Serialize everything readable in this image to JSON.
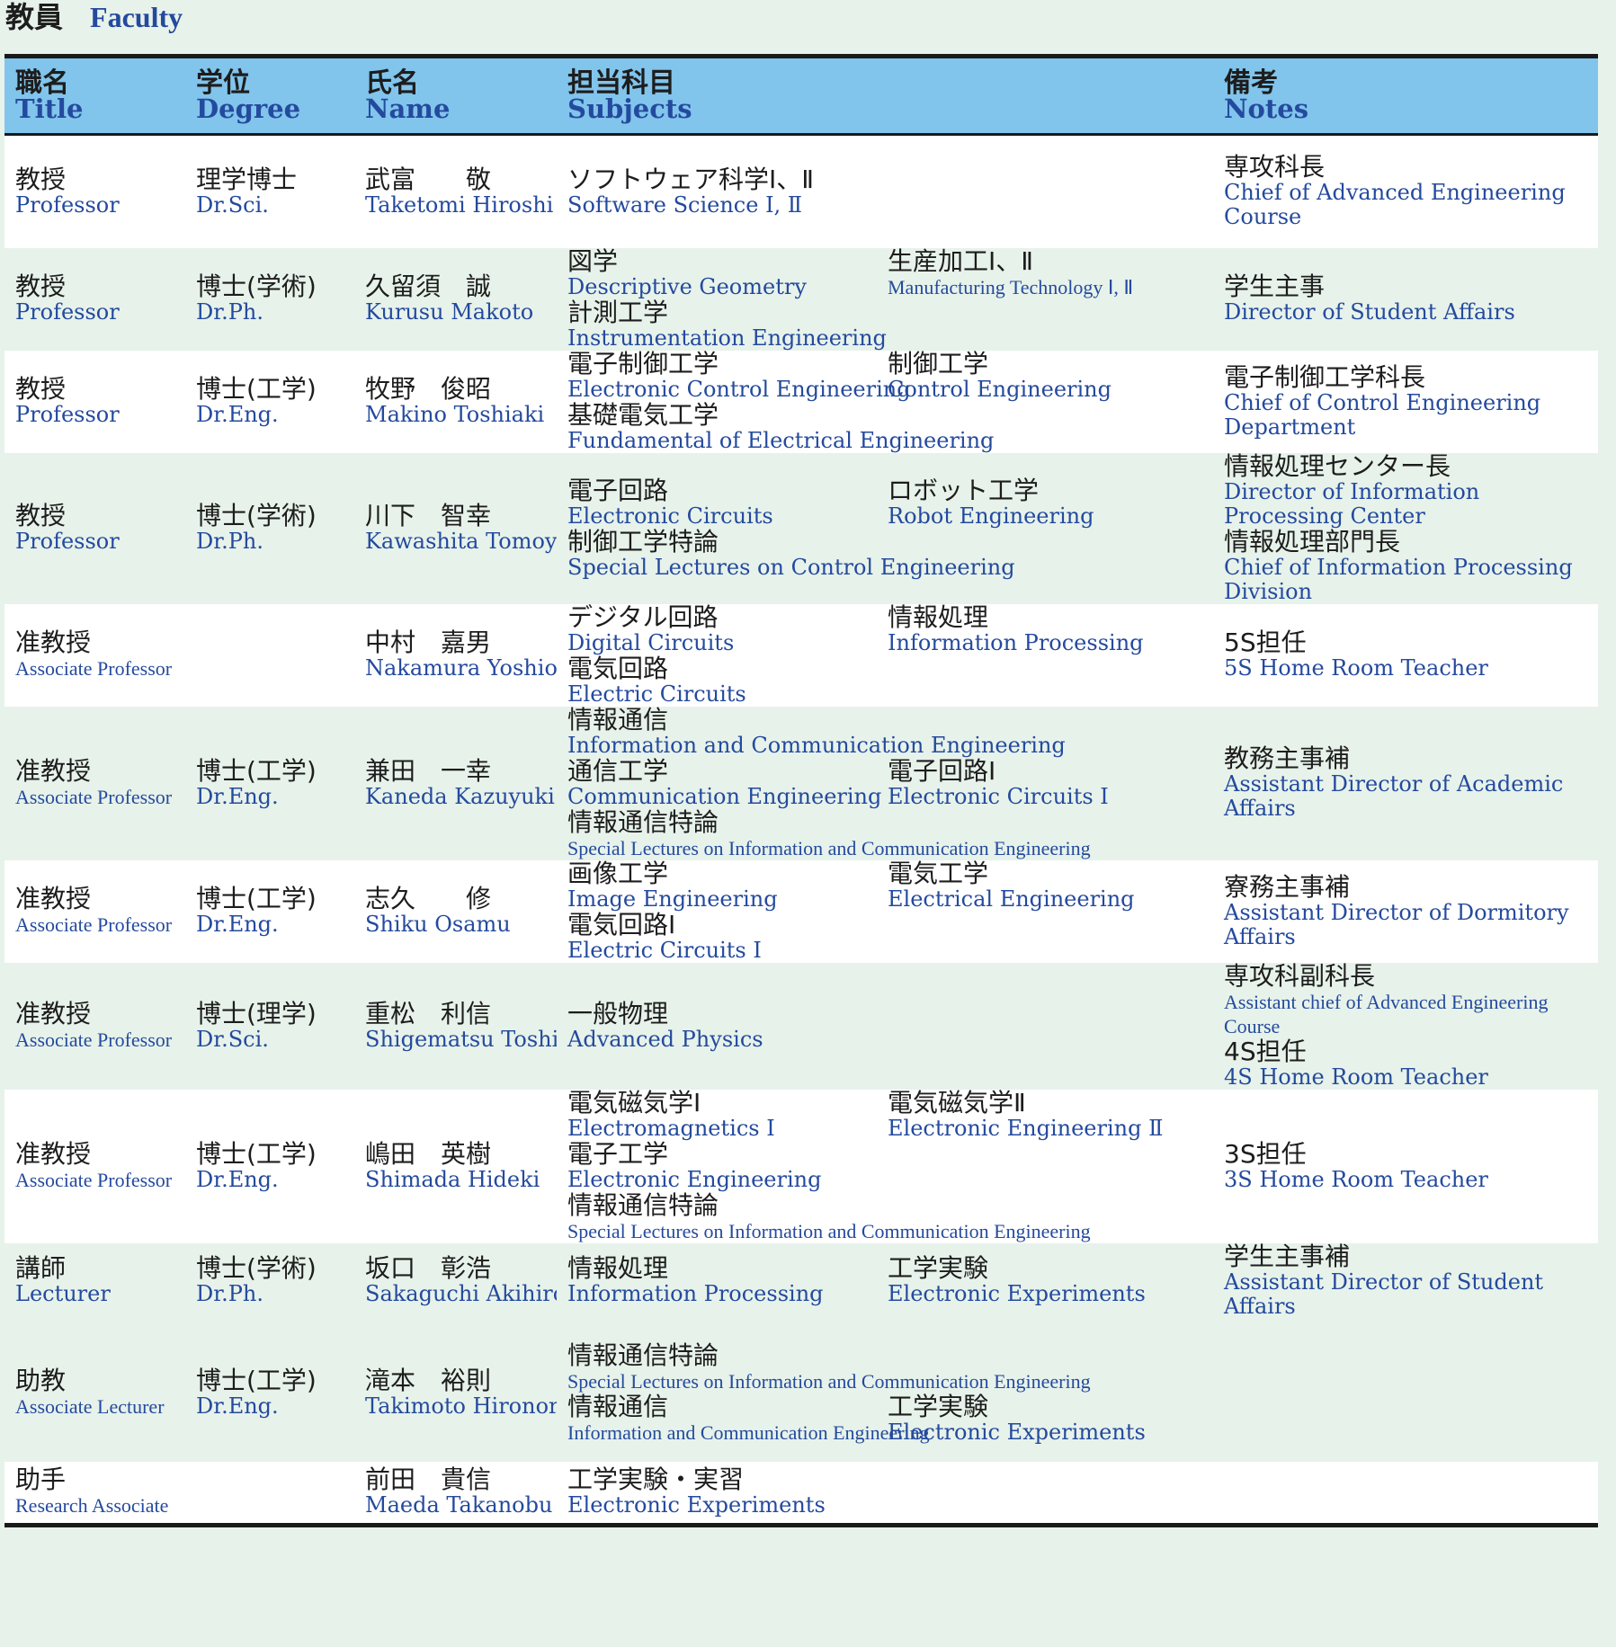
{
  "page_title": {
    "ja": "教員",
    "en": "Faculty"
  },
  "columns": [
    {
      "ja": "職名",
      "en": "Title"
    },
    {
      "ja": "学位",
      "en": "Degree"
    },
    {
      "ja": "氏名",
      "en": "Name"
    },
    {
      "ja": "担当科目",
      "en": "Subjects"
    },
    {
      "ja": "備考",
      "en": "Notes"
    }
  ],
  "rows": [
    {
      "title_ja": "教授",
      "title_en": "Professor",
      "degree_ja": "理学博士",
      "degree_en": "Dr.Sci.",
      "name_ja": "武富　　敬",
      "name_en": "Taketomi Hiroshi",
      "subjects": [
        {
          "ja": "ソフトウェア科学Ⅰ、Ⅱ",
          "en": "Software Science Ⅰ, Ⅱ",
          "wide": true
        }
      ],
      "notes": [
        {
          "ja": "専攻科長",
          "en": "Chief of Advanced Engineering Course"
        }
      ]
    },
    {
      "title_ja": "教授",
      "title_en": "Professor",
      "degree_ja": "博士(学術)",
      "degree_en": "Dr.Ph.",
      "name_ja": "久留須　誠",
      "name_en": "Kurusu Makoto",
      "subjects": [
        {
          "ja": "図学",
          "en": "Descriptive Geometry"
        },
        {
          "ja": "生産加工Ⅰ、Ⅱ",
          "en": "Manufacturing Technology Ⅰ, Ⅱ",
          "small": true
        },
        {
          "ja": "計測工学",
          "en": "Instrumentation Engineering",
          "wide": true
        }
      ],
      "notes": [
        {
          "ja": "学生主事",
          "en": "Director of Student Affairs"
        }
      ]
    },
    {
      "title_ja": "教授",
      "title_en": "Professor",
      "degree_ja": "博士(工学)",
      "degree_en": "Dr.Eng.",
      "name_ja": "牧野　俊昭",
      "name_en": "Makino Toshiaki",
      "subjects": [
        {
          "ja": "電子制御工学",
          "en": "Electronic Control Engineering"
        },
        {
          "ja": "制御工学",
          "en": "Control Engineering"
        },
        {
          "ja": "基礎電気工学",
          "en": "Fundamental of Electrical Engineering",
          "wide": true
        }
      ],
      "notes": [
        {
          "ja": "電子制御工学科長",
          "en": "Chief of Control Engineering Department"
        }
      ]
    },
    {
      "title_ja": "教授",
      "title_en": "Professor",
      "degree_ja": "博士(学術)",
      "degree_en": "Dr.Ph.",
      "name_ja": "川下　智幸",
      "name_en": "Kawashita Tomoyuki",
      "subjects": [
        {
          "ja": "電子回路",
          "en": "Electronic Circuits"
        },
        {
          "ja": "ロボット工学",
          "en": "Robot Engineering"
        },
        {
          "ja": "制御工学特論",
          "en": "Special Lectures on Control Engineering",
          "wide": true
        }
      ],
      "notes": [
        {
          "ja": "情報処理センター長",
          "en": "Director of Information Processing Center"
        },
        {
          "ja": "情報処理部門長",
          "en": "Chief of Information Processing Division"
        }
      ]
    },
    {
      "title_ja": "准教授",
      "title_en": "Associate Professor",
      "degree_ja": "",
      "degree_en": "",
      "name_ja": "中村　嘉男",
      "name_en": "Nakamura Yoshio",
      "subjects": [
        {
          "ja": "デジタル回路",
          "en": "Digital Circuits"
        },
        {
          "ja": "情報処理",
          "en": "Information Processing"
        },
        {
          "ja": "電気回路",
          "en": "Electric Circuits",
          "wide": true
        }
      ],
      "notes": [
        {
          "ja": "5S担任",
          "en": "5S Home Room Teacher"
        }
      ]
    },
    {
      "title_ja": "准教授",
      "title_en": "Associate Professor",
      "degree_ja": "博士(工学)",
      "degree_en": "Dr.Eng.",
      "name_ja": "兼田　一幸",
      "name_en": "Kaneda Kazuyuki",
      "subjects": [
        {
          "ja": "情報通信",
          "en": "Information and Communication Engineering",
          "wide": true
        },
        {
          "ja": "通信工学",
          "en": "Communication Engineering"
        },
        {
          "ja": "電子回路Ⅰ",
          "en": "Electronic Circuits Ⅰ"
        },
        {
          "ja": "情報通信特論",
          "en": "Special Lectures on Information and Communication Engineering",
          "wide": true,
          "small": true
        }
      ],
      "notes": [
        {
          "ja": "教務主事補",
          "en": "Assistant Director of Academic Affairs"
        }
      ]
    },
    {
      "title_ja": "准教授",
      "title_en": "Associate Professor",
      "degree_ja": "博士(工学)",
      "degree_en": "Dr.Eng.",
      "name_ja": "志久　　修",
      "name_en": "Shiku Osamu",
      "subjects": [
        {
          "ja": "画像工学",
          "en": "Image Engineering"
        },
        {
          "ja": "電気工学",
          "en": "Electrical Engineering"
        },
        {
          "ja": "電気回路Ⅰ",
          "en": "Electric Circuits Ⅰ",
          "wide": true
        }
      ],
      "notes": [
        {
          "ja": "寮務主事補",
          "en": "Assistant Director of Dormitory Affairs"
        }
      ]
    },
    {
      "title_ja": "准教授",
      "title_en": "Associate Professor",
      "degree_ja": "博士(理学)",
      "degree_en": "Dr.Sci.",
      "name_ja": "重松　利信",
      "name_en": "Shigematsu Toshinobu",
      "subjects": [
        {
          "ja": "一般物理",
          "en": "Advanced Physics",
          "wide": true
        }
      ],
      "notes": [
        {
          "ja": "専攻科副科長",
          "en": "Assistant chief of Advanced Engineering Course",
          "small": true
        },
        {
          "ja": "4S担任",
          "en": "4S Home Room Teacher"
        }
      ]
    },
    {
      "title_ja": "准教授",
      "title_en": "Associate Professor",
      "degree_ja": "博士(工学)",
      "degree_en": "Dr.Eng.",
      "name_ja": "嶋田　英樹",
      "name_en": "Shimada Hideki",
      "subjects": [
        {
          "ja": "電気磁気学Ⅰ",
          "en": "Electromagnetics Ⅰ"
        },
        {
          "ja": "電気磁気学Ⅱ",
          "en": "Electronic Engineering Ⅱ"
        },
        {
          "ja": "電子工学",
          "en": "Electronic Engineering",
          "wide": true
        },
        {
          "ja": "情報通信特論",
          "en": "Special Lectures on Information and Communication Engineering",
          "wide": true,
          "small": true
        }
      ],
      "notes": [
        {
          "ja": "3S担任",
          "en": "3S Home Room Teacher"
        }
      ]
    },
    {
      "title_ja": "講師",
      "title_en": "Lecturer",
      "degree_ja": "博士(学術)",
      "degree_en": "Dr.Ph.",
      "name_ja": "坂口　彰浩",
      "name_en": "Sakaguchi Akihiro",
      "subjects": [
        {
          "ja": "情報処理",
          "en": "Information Processing"
        },
        {
          "ja": "工学実験",
          "en": "Electronic Experiments"
        }
      ],
      "notes": [
        {
          "ja": "学生主事補",
          "en": "Assistant Director of Student Affairs"
        }
      ]
    },
    {
      "title_ja": "助教",
      "title_en": "Associate Lecturer",
      "degree_ja": "博士(工学)",
      "degree_en": "Dr.Eng.",
      "name_ja": "滝本　裕則",
      "name_en": "Takimoto Hironori",
      "subjects": [
        {
          "ja": "情報通信特論",
          "en": "Special Lectures on Information and Communication Engineering",
          "wide": true,
          "small": true
        },
        {
          "ja": "情報通信",
          "en": "Information and Communication Engineering",
          "small": true
        },
        {
          "ja": "工学実験",
          "en": "Electronic Experiments"
        }
      ],
      "notes": []
    },
    {
      "title_ja": "助手",
      "title_en": "Research Associate",
      "degree_ja": "",
      "degree_en": "",
      "name_ja": "前田　貴信",
      "name_en": "Maeda Takanobu",
      "subjects": [
        {
          "ja": "工学実験・実習",
          "en": "Electronic Experiments",
          "wide": true
        }
      ],
      "notes": []
    }
  ]
}
